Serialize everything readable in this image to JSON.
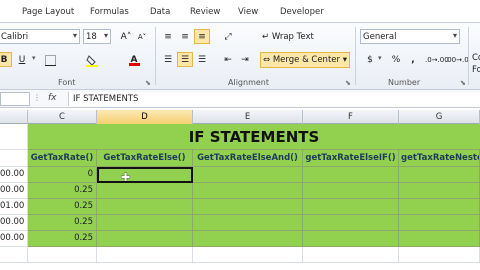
{
  "tabs": [
    "Page Layout",
    "Formulas",
    "Data",
    "Review",
    "View",
    "Developer"
  ],
  "font": {
    "name": "Calibri",
    "size": "18",
    "grow_icon": "A˄",
    "shrink_icon": "A˅",
    "bold": "B",
    "underline": "U",
    "font_color": "A",
    "group_label": "Font"
  },
  "alignment": {
    "wrap_text": "Wrap Text",
    "merge_center": "Merge & Center",
    "group_label": "Alignment"
  },
  "number": {
    "format": "General",
    "currency": "$",
    "percent": "%",
    "comma": ",",
    "inc_decimal": ".0→.00",
    "dec_decimal": ".00→.0",
    "group_label": "Number"
  },
  "styles": {
    "conditional": "Co",
    "format_as": "Fo"
  },
  "formula_bar": {
    "fx": "fx",
    "content": "IF STATEMENTS"
  },
  "colors": {
    "sheet_green": "#92d050",
    "selected_header": "#f5cf6f"
  },
  "columns": [
    {
      "letter": "C",
      "header": "GetTaxRate()"
    },
    {
      "letter": "D",
      "header": "GetTaxRateElse()"
    },
    {
      "letter": "E",
      "header": "GetTaxRateElseAnd()"
    },
    {
      "letter": "F",
      "header": "getTaxRateElseIF()"
    },
    {
      "letter": "G",
      "header": "getTaxRateNeste"
    }
  ],
  "sheet": {
    "title": "IF STATEMENTS",
    "b_values": [
      "00.00",
      "00.00",
      "01.00",
      "00.00",
      "00.00"
    ],
    "c_values": [
      "0",
      "0.25",
      "0.25",
      "0.25",
      "0.25"
    ]
  }
}
